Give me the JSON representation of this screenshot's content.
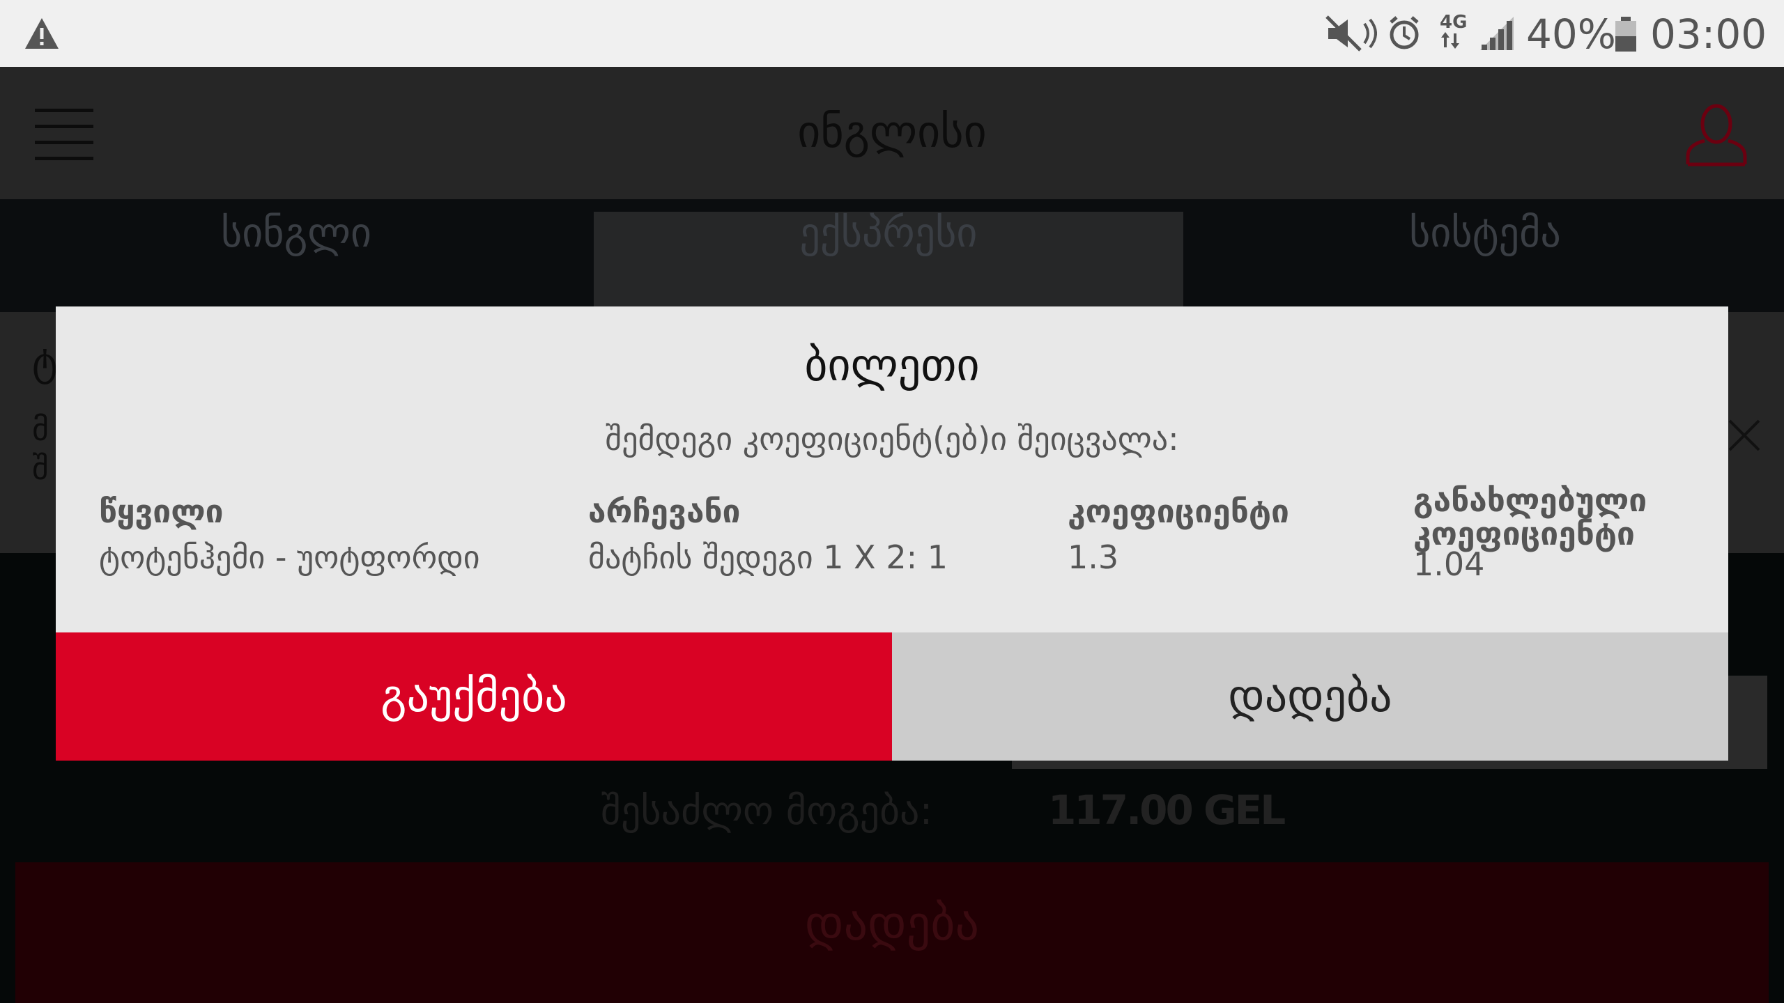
{
  "status_bar": {
    "icons": [
      "warning-icon",
      "mute-icon",
      "alarm-icon",
      "network-4g-icon",
      "signal-icon",
      "battery-icon"
    ],
    "network_label": "4G",
    "battery": "40%",
    "time": "03:00"
  },
  "toolbar": {
    "title": "ინგლისი"
  },
  "tabs": [
    {
      "label": "სინგლი"
    },
    {
      "label": "ექსპრესი"
    },
    {
      "label": "სისტემა"
    }
  ],
  "background": {
    "panel_letter_1": "ტ",
    "panel_letter_2": "მ",
    "panel_letter_3": "შ",
    "possible_winnings_label": "შესაძლო მოგება:",
    "possible_winnings_value": "117.00 GEL",
    "place_bet_label": "დადება"
  },
  "modal": {
    "title": "ბილეთი",
    "message": "შემდეგი კოეფიციენტ(ებ)ი შეიცვალა:",
    "columns": [
      {
        "header": "წყვილი",
        "value": "ტოტენჰემი - უოტფორდი"
      },
      {
        "header": "არჩევანი",
        "value": "მატჩის შედეგი 1 X 2: 1"
      },
      {
        "header": "კოეფიციენტი",
        "value": "1.3"
      },
      {
        "header": "განახლებული კოეფიციენტი",
        "value": "1.04"
      }
    ],
    "cancel_label": "გაუქმება",
    "confirm_label": "დადება"
  },
  "colors": {
    "accent_red": "#d90224",
    "dialog_bg": "#e8e8e8",
    "confirm_bg": "#cccccc",
    "toolbar_bg": "#262626"
  }
}
